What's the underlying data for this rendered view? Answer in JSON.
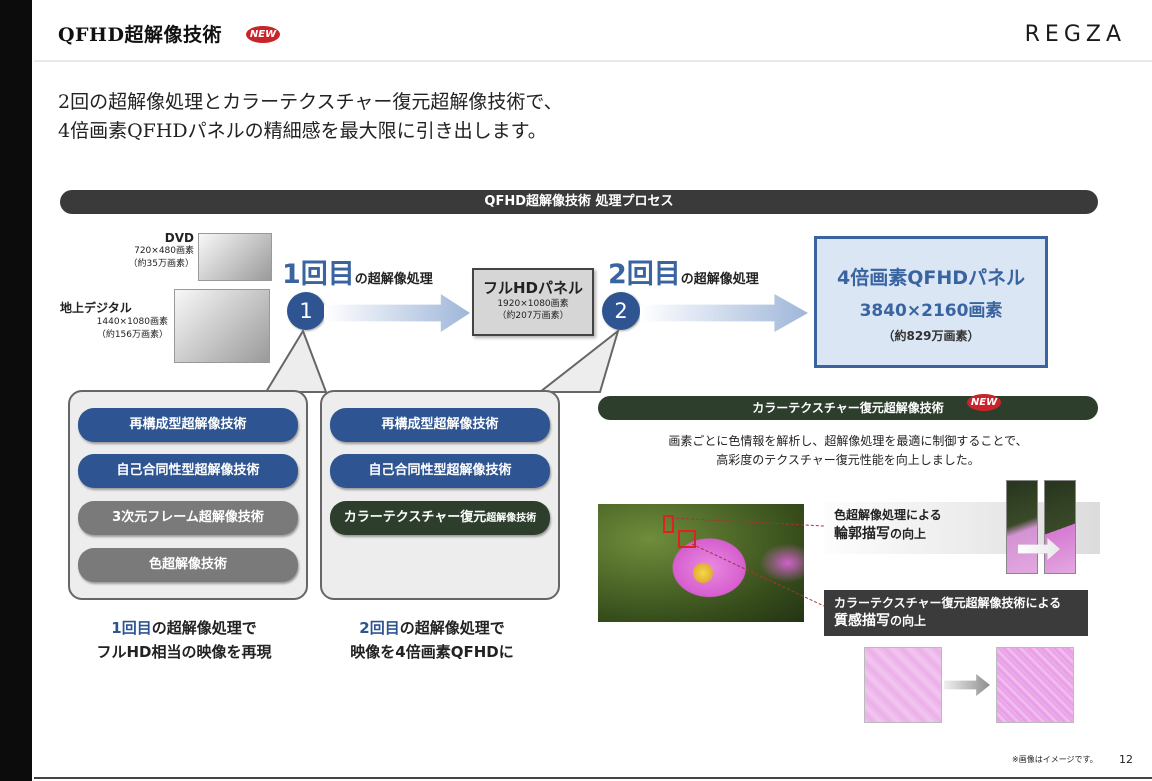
{
  "header": {
    "title": "QFHD超解像技術",
    "badge": "NEW",
    "brand": "REGZA"
  },
  "lead": {
    "line1": "2回の超解像処理とカラーテクスチャー復元超解像技術で、",
    "line2": "4倍画素QFHDパネルの精細感を最大限に引き出します。"
  },
  "process": {
    "band_title": "QFHD超解像技術 処理プロセス",
    "sources": [
      {
        "title": "DVD",
        "line1": "720×480画素",
        "line2": "（約35万画素）"
      },
      {
        "title": "地上デジタル",
        "line1": "1440×1080画素",
        "line2": "（約156万画素）"
      }
    ],
    "step1": {
      "num": "1回目",
      "label": "の超解像処理",
      "circle": "1"
    },
    "step2": {
      "num": "2回目",
      "label": "の超解像処理",
      "circle": "2"
    },
    "fhd_panel": {
      "title": "フルHDパネル",
      "line1": "1920×1080画素",
      "line2": "（約207万画素）"
    },
    "qfhd_panel": {
      "title": "4倍画素QFHDパネル",
      "res": "3840×2160画素",
      "pixels": "（約829万画素）"
    }
  },
  "group1": {
    "items": [
      "再構成型超解像技術",
      "自己合同性型超解像技術",
      "3次元フレーム超解像技術",
      "色超解像技術"
    ],
    "caption_hl": "1回目",
    "caption_line1": "の超解像処理で",
    "caption_line2": "フルHD相当の映像を再現"
  },
  "group2": {
    "items": [
      "再構成型超解像技術",
      "自己合同性型超解像技術"
    ],
    "item3_main": "カラーテクスチャー復元",
    "item3_small": "超解像技術",
    "caption_hl": "2回目",
    "caption_line1": "の超解像処理で",
    "caption_line2": "映像を4倍画素QFHDに"
  },
  "color_texture": {
    "band_title": "カラーテクスチャー復元超解像技術",
    "badge": "NEW",
    "desc1": "画素ごとに色情報を解析し、超解像処理を最適に制御することで、",
    "desc2": "高彩度のテクスチャー復元性能を向上しました。",
    "enh1": {
      "line1": "色超解像処理による",
      "line2_big": "輪郭描写",
      "line2_small": "の向上"
    },
    "enh2": {
      "line1": "カラーテクスチャー復元超解像技術による",
      "line2_big": "質感描写",
      "line2_small": "の向上"
    }
  },
  "footer": {
    "note": "※画像はイメージです。",
    "page": "12"
  },
  "colors": {
    "accent_blue": "#2e5592",
    "dark_green": "#2d3e2d",
    "new_red": "#c8242a"
  }
}
